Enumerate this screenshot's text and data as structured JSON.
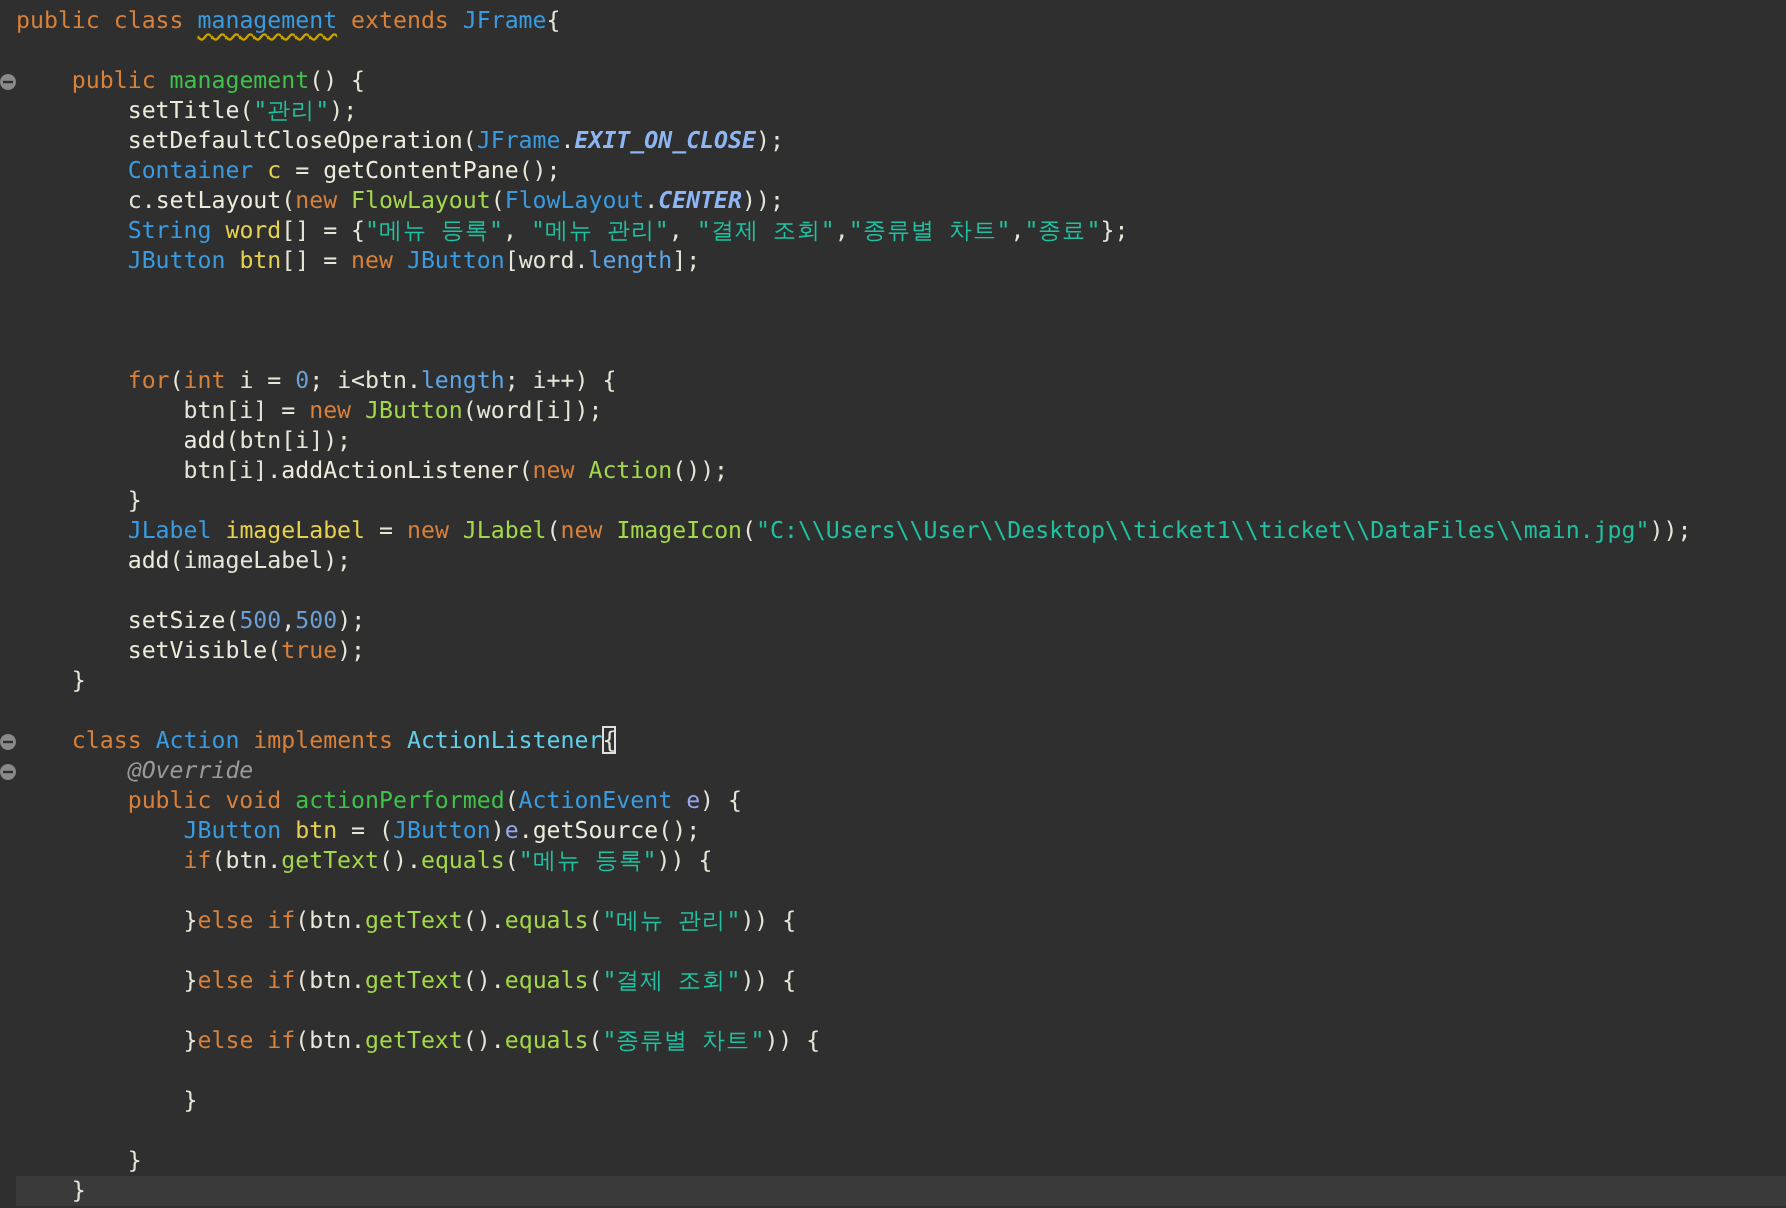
{
  "editor": {
    "lines": [
      {
        "kind": "code",
        "fold": false,
        "current": false,
        "tokens": [
          {
            "kind": "keyword",
            "text": "public class "
          },
          {
            "kind": "error",
            "text": "management"
          },
          {
            "kind": "keyword",
            "text": " extends "
          },
          {
            "kind": "type",
            "text": "JFrame"
          },
          {
            "kind": "plain",
            "text": "{"
          }
        ]
      },
      {
        "kind": "blank"
      },
      {
        "kind": "code",
        "fold": true,
        "current": false,
        "tokens": [
          {
            "kind": "keyword",
            "text": "public "
          },
          {
            "kind": "declaration",
            "text": "management"
          },
          {
            "kind": "plain",
            "text": "() {"
          }
        ]
      },
      {
        "kind": "code",
        "fold": false,
        "current": false,
        "tokens": [
          {
            "kind": "call",
            "text": "setTitle"
          },
          {
            "kind": "plain",
            "text": "("
          },
          {
            "kind": "string",
            "text": "\"관리\""
          },
          {
            "kind": "plain",
            "text": ");"
          }
        ]
      },
      {
        "kind": "code",
        "fold": false,
        "current": false,
        "tokens": [
          {
            "kind": "call",
            "text": "setDefaultCloseOperation"
          },
          {
            "kind": "plain",
            "text": "("
          },
          {
            "kind": "type",
            "text": "JFrame"
          },
          {
            "kind": "plain",
            "text": "."
          },
          {
            "kind": "constant",
            "text": "EXIT_ON_CLOSE"
          },
          {
            "kind": "plain",
            "text": ");"
          }
        ]
      },
      {
        "kind": "code",
        "fold": false,
        "current": false,
        "tokens": [
          {
            "kind": "type",
            "text": "Container "
          },
          {
            "kind": "variable",
            "text": "c"
          },
          {
            "kind": "plain",
            "text": " = "
          },
          {
            "kind": "call",
            "text": "getContentPane"
          },
          {
            "kind": "plain",
            "text": "();"
          }
        ]
      },
      {
        "kind": "code",
        "fold": false,
        "current": false,
        "tokens": [
          {
            "kind": "plain",
            "text": "c."
          },
          {
            "kind": "call",
            "text": "setLayout"
          },
          {
            "kind": "plain",
            "text": "("
          },
          {
            "kind": "keyword",
            "text": "new "
          },
          {
            "kind": "method",
            "text": "FlowLayout"
          },
          {
            "kind": "plain",
            "text": "("
          },
          {
            "kind": "type",
            "text": "FlowLayout"
          },
          {
            "kind": "plain",
            "text": "."
          },
          {
            "kind": "constant",
            "text": "CENTER"
          },
          {
            "kind": "plain",
            "text": "));"
          }
        ]
      },
      {
        "kind": "code",
        "fold": false,
        "current": false,
        "tokens": [
          {
            "kind": "type",
            "text": "String "
          },
          {
            "kind": "variable",
            "text": "word"
          },
          {
            "kind": "plain",
            "text": "[] = {"
          },
          {
            "kind": "string",
            "text": "\"메뉴 등록\""
          },
          {
            "kind": "plain",
            "text": ", "
          },
          {
            "kind": "string",
            "text": "\"메뉴 관리\""
          },
          {
            "kind": "plain",
            "text": ", "
          },
          {
            "kind": "string",
            "text": "\"결제 조회\""
          },
          {
            "kind": "plain",
            "text": ","
          },
          {
            "kind": "string",
            "text": "\"종류별 차트\""
          },
          {
            "kind": "plain",
            "text": ","
          },
          {
            "kind": "string",
            "text": "\"종료\""
          },
          {
            "kind": "plain",
            "text": "};"
          }
        ]
      },
      {
        "kind": "code",
        "fold": false,
        "current": false,
        "tokens": [
          {
            "kind": "type",
            "text": "JButton "
          },
          {
            "kind": "variable",
            "text": "btn"
          },
          {
            "kind": "plain",
            "text": "[] = "
          },
          {
            "kind": "keyword",
            "text": "new "
          },
          {
            "kind": "type",
            "text": "JButton"
          },
          {
            "kind": "plain",
            "text": "[word."
          },
          {
            "kind": "field",
            "text": "length"
          },
          {
            "kind": "plain",
            "text": "];"
          }
        ]
      },
      {
        "kind": "blank"
      },
      {
        "kind": "blank"
      },
      {
        "kind": "blank"
      },
      {
        "kind": "code",
        "fold": false,
        "current": false,
        "tokens": [
          {
            "kind": "keyword",
            "text": "for"
          },
          {
            "kind": "plain",
            "text": "("
          },
          {
            "kind": "keyword",
            "text": "int "
          },
          {
            "kind": "plain",
            "text": "i = "
          },
          {
            "kind": "number",
            "text": "0"
          },
          {
            "kind": "plain",
            "text": "; i<btn."
          },
          {
            "kind": "field",
            "text": "length"
          },
          {
            "kind": "plain",
            "text": "; i++) {"
          }
        ]
      },
      {
        "kind": "code",
        "fold": false,
        "current": false,
        "tokens": [
          {
            "kind": "plain",
            "text": "btn[i] = "
          },
          {
            "kind": "keyword",
            "text": "new "
          },
          {
            "kind": "method",
            "text": "JButton"
          },
          {
            "kind": "plain",
            "text": "(word[i]);"
          }
        ]
      },
      {
        "kind": "code",
        "fold": false,
        "current": false,
        "tokens": [
          {
            "kind": "call",
            "text": "add"
          },
          {
            "kind": "plain",
            "text": "(btn[i]);"
          }
        ]
      },
      {
        "kind": "code",
        "fold": false,
        "current": false,
        "tokens": [
          {
            "kind": "plain",
            "text": "btn[i]."
          },
          {
            "kind": "call",
            "text": "addActionListener"
          },
          {
            "kind": "plain",
            "text": "("
          },
          {
            "kind": "keyword",
            "text": "new "
          },
          {
            "kind": "method",
            "text": "Action"
          },
          {
            "kind": "plain",
            "text": "());"
          }
        ]
      },
      {
        "kind": "code",
        "fold": false,
        "current": false,
        "tokens": [
          {
            "kind": "plain",
            "text": "}"
          }
        ]
      },
      {
        "kind": "code",
        "fold": false,
        "current": false,
        "tokens": [
          {
            "kind": "type",
            "text": "JLabel "
          },
          {
            "kind": "variable",
            "text": "imageLabel"
          },
          {
            "kind": "plain",
            "text": " = "
          },
          {
            "kind": "keyword",
            "text": "new "
          },
          {
            "kind": "method",
            "text": "JLabel"
          },
          {
            "kind": "plain",
            "text": "("
          },
          {
            "kind": "keyword",
            "text": "new "
          },
          {
            "kind": "method",
            "text": "ImageIcon"
          },
          {
            "kind": "plain",
            "text": "("
          },
          {
            "kind": "string",
            "text": "\"C:\\\\Users\\\\User\\\\Desktop\\\\ticket1\\\\ticket\\\\DataFiles\\\\main.jpg\""
          },
          {
            "kind": "plain",
            "text": "));"
          }
        ]
      },
      {
        "kind": "code",
        "fold": false,
        "current": false,
        "tokens": [
          {
            "kind": "call",
            "text": "add"
          },
          {
            "kind": "plain",
            "text": "(imageLabel);"
          }
        ]
      },
      {
        "kind": "blank"
      },
      {
        "kind": "code",
        "fold": false,
        "current": false,
        "tokens": [
          {
            "kind": "call",
            "text": "setSize"
          },
          {
            "kind": "plain",
            "text": "("
          },
          {
            "kind": "number",
            "text": "500"
          },
          {
            "kind": "plain",
            "text": ","
          },
          {
            "kind": "number",
            "text": "500"
          },
          {
            "kind": "plain",
            "text": ");"
          }
        ]
      },
      {
        "kind": "code",
        "fold": false,
        "current": false,
        "tokens": [
          {
            "kind": "call",
            "text": "setVisible"
          },
          {
            "kind": "plain",
            "text": "("
          },
          {
            "kind": "keyword",
            "text": "true"
          },
          {
            "kind": "plain",
            "text": ");"
          }
        ]
      },
      {
        "kind": "code",
        "fold": false,
        "current": false,
        "tokens": [
          {
            "kind": "plain",
            "text": "}"
          }
        ]
      },
      {
        "kind": "blank"
      },
      {
        "kind": "code",
        "fold": true,
        "current": false,
        "tokens": [
          {
            "kind": "keyword",
            "text": "class "
          },
          {
            "kind": "type",
            "text": "Action"
          },
          {
            "kind": "keyword",
            "text": " implements "
          },
          {
            "kind": "interface",
            "text": "ActionListener"
          },
          {
            "kind": "bracket_match",
            "text": "{"
          }
        ]
      },
      {
        "kind": "code",
        "fold": true,
        "current": false,
        "tokens": [
          {
            "kind": "annotation",
            "text": "@Override"
          }
        ]
      },
      {
        "kind": "code",
        "fold": false,
        "current": false,
        "tokens": [
          {
            "kind": "keyword",
            "text": "public void "
          },
          {
            "kind": "declaration",
            "text": "actionPerformed"
          },
          {
            "kind": "plain",
            "text": "("
          },
          {
            "kind": "type",
            "text": "ActionEvent "
          },
          {
            "kind": "param",
            "text": "e"
          },
          {
            "kind": "plain",
            "text": ") {"
          }
        ]
      },
      {
        "kind": "code",
        "fold": false,
        "current": false,
        "tokens": [
          {
            "kind": "type",
            "text": "JButton "
          },
          {
            "kind": "variable",
            "text": "btn"
          },
          {
            "kind": "plain",
            "text": " = ("
          },
          {
            "kind": "type",
            "text": "JButton"
          },
          {
            "kind": "plain",
            "text": ")"
          },
          {
            "kind": "param",
            "text": "e"
          },
          {
            "kind": "plain",
            "text": "."
          },
          {
            "kind": "call",
            "text": "getSource"
          },
          {
            "kind": "plain",
            "text": "();"
          }
        ]
      },
      {
        "kind": "code",
        "fold": false,
        "current": false,
        "tokens": [
          {
            "kind": "keyword",
            "text": "if"
          },
          {
            "kind": "plain",
            "text": "(btn."
          },
          {
            "kind": "method",
            "text": "getText"
          },
          {
            "kind": "plain",
            "text": "()."
          },
          {
            "kind": "method",
            "text": "equals"
          },
          {
            "kind": "plain",
            "text": "("
          },
          {
            "kind": "string",
            "text": "\"메뉴 등록\""
          },
          {
            "kind": "plain",
            "text": ")) {"
          }
        ]
      },
      {
        "kind": "blank"
      },
      {
        "kind": "code",
        "fold": false,
        "current": false,
        "tokens": [
          {
            "kind": "plain",
            "text": "}"
          },
          {
            "kind": "keyword",
            "text": "else if"
          },
          {
            "kind": "plain",
            "text": "(btn."
          },
          {
            "kind": "method",
            "text": "getText"
          },
          {
            "kind": "plain",
            "text": "()."
          },
          {
            "kind": "method",
            "text": "equals"
          },
          {
            "kind": "plain",
            "text": "("
          },
          {
            "kind": "string",
            "text": "\"메뉴 관리\""
          },
          {
            "kind": "plain",
            "text": ")) {"
          }
        ]
      },
      {
        "kind": "blank"
      },
      {
        "kind": "code",
        "fold": false,
        "current": false,
        "tokens": [
          {
            "kind": "plain",
            "text": "}"
          },
          {
            "kind": "keyword",
            "text": "else if"
          },
          {
            "kind": "plain",
            "text": "(btn."
          },
          {
            "kind": "method",
            "text": "getText"
          },
          {
            "kind": "plain",
            "text": "()."
          },
          {
            "kind": "method",
            "text": "equals"
          },
          {
            "kind": "plain",
            "text": "("
          },
          {
            "kind": "string",
            "text": "\"결제 조회\""
          },
          {
            "kind": "plain",
            "text": ")) {"
          }
        ]
      },
      {
        "kind": "blank"
      },
      {
        "kind": "code",
        "fold": false,
        "current": false,
        "tokens": [
          {
            "kind": "plain",
            "text": "}"
          },
          {
            "kind": "keyword",
            "text": "else if"
          },
          {
            "kind": "plain",
            "text": "(btn."
          },
          {
            "kind": "method",
            "text": "getText"
          },
          {
            "kind": "plain",
            "text": "()."
          },
          {
            "kind": "method",
            "text": "equals"
          },
          {
            "kind": "plain",
            "text": "("
          },
          {
            "kind": "string",
            "text": "\"종류별 차트\""
          },
          {
            "kind": "plain",
            "text": ")) {"
          }
        ]
      },
      {
        "kind": "blank"
      },
      {
        "kind": "code",
        "fold": false,
        "current": false,
        "tokens": [
          {
            "kind": "plain",
            "text": "}"
          }
        ]
      },
      {
        "kind": "blank"
      },
      {
        "kind": "code",
        "fold": false,
        "current": false,
        "tokens": [
          {
            "kind": "plain",
            "text": "}"
          }
        ]
      },
      {
        "kind": "code",
        "fold": false,
        "current": true,
        "tokens": [
          {
            "kind": "plain",
            "text": "}"
          }
        ]
      }
    ]
  }
}
